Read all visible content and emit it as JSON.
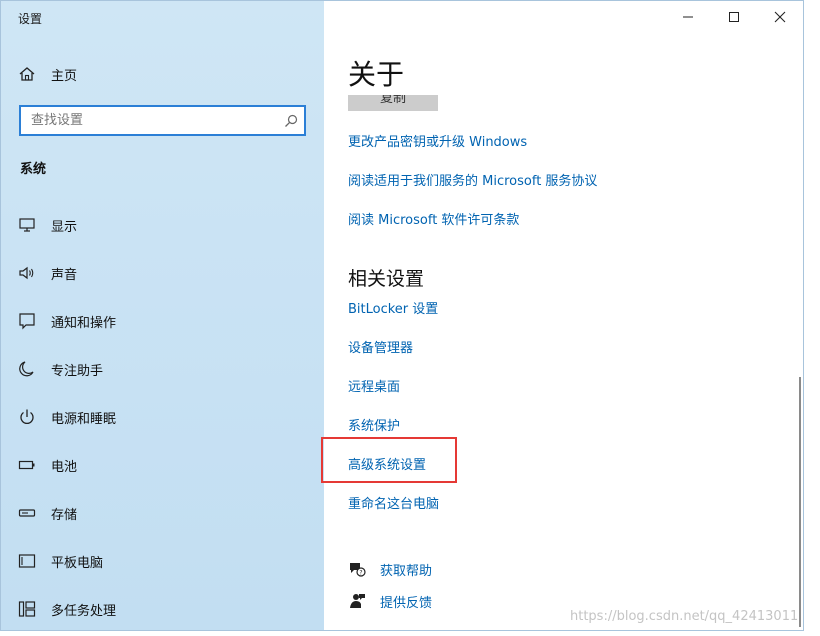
{
  "app_title": "设置",
  "sidebar": {
    "home_label": "主页",
    "search_placeholder": "查找设置",
    "section_label": "系统",
    "items": [
      {
        "label": "显示",
        "icon": "monitor-icon"
      },
      {
        "label": "声音",
        "icon": "speaker-icon"
      },
      {
        "label": "通知和操作",
        "icon": "notification-icon"
      },
      {
        "label": "专注助手",
        "icon": "moon-icon"
      },
      {
        "label": "电源和睡眠",
        "icon": "power-icon"
      },
      {
        "label": "电池",
        "icon": "battery-icon"
      },
      {
        "label": "存储",
        "icon": "storage-icon"
      },
      {
        "label": "平板电脑",
        "icon": "tablet-icon"
      },
      {
        "label": "多任务处理",
        "icon": "multitask-icon"
      }
    ]
  },
  "main": {
    "title": "关于",
    "copy_label": "复制",
    "links": [
      "更改产品密钥或升级 Windows",
      "阅读适用于我们服务的 Microsoft 服务协议",
      "阅读 Microsoft 软件许可条款"
    ],
    "related_title": "相关设置",
    "related_links": [
      "BitLocker 设置",
      "设备管理器",
      "远程桌面",
      "系统保护",
      "高级系统设置",
      "重命名这台电脑"
    ],
    "help_links": [
      {
        "label": "获取帮助",
        "icon": "help-chat-icon"
      },
      {
        "label": "提供反馈",
        "icon": "feedback-icon"
      }
    ]
  },
  "watermark": "https://blog.csdn.net/qq_42413011",
  "colors": {
    "sidebar_bg": "#c8e2f4",
    "link": "#0063b1",
    "highlight": "#e53935",
    "search_border": "#2b7fd6"
  }
}
